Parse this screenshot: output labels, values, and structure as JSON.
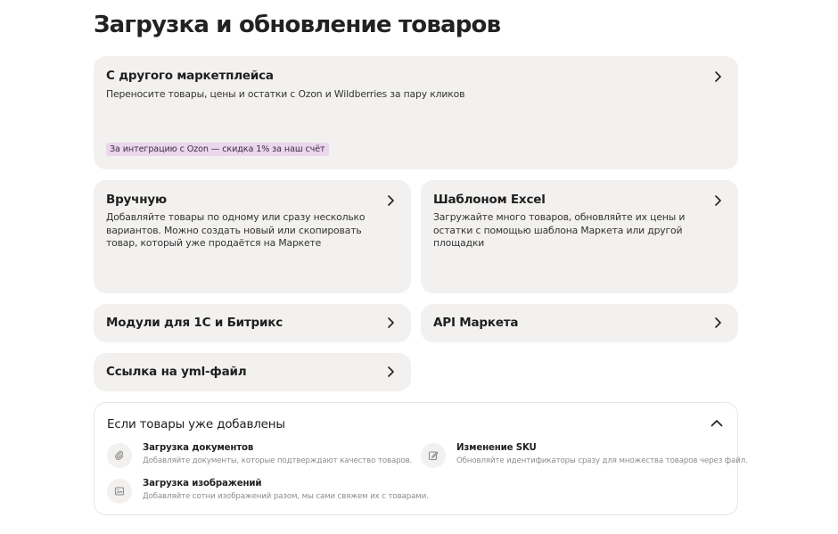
{
  "page": {
    "title": "Загрузка и обновление товаров"
  },
  "cards": {
    "marketplace": {
      "title": "С другого маркетплейса",
      "description": "Переносите товары, цены и остатки с Ozon и Wildberries за пару кликов",
      "promo": "За интеграцию с Ozon — скидка 1% за наш счёт",
      "icon": "chevron-right-icon"
    },
    "manual": {
      "title": "Вручную",
      "description": "Добавляйте товары по одному или сразу несколько вариантов. Можно создать новый или скопировать товар, который уже продаётся на Маркете",
      "icon": "chevron-right-icon"
    },
    "excel": {
      "title": "Шаблоном Excel",
      "description": "Загружайте много товаров, обновляйте их цены и остатки с помощью шаблона Маркета или другой площадки",
      "icon": "chevron-right-icon"
    },
    "modules": {
      "title": "Модули для 1С и Битрикс",
      "icon": "chevron-right-icon"
    },
    "api": {
      "title": "API Маркета",
      "icon": "chevron-right-icon"
    },
    "yml": {
      "title": "Ссылка на yml-файл",
      "icon": "chevron-right-icon"
    }
  },
  "added_section": {
    "title": "Если товары уже добавлены",
    "toggle_icon": "chevron-up-icon",
    "items": [
      {
        "title": "Загрузка документов",
        "description": "Добавляйте документы, которые подтверждают качество товаров.",
        "icon": "paperclip-icon"
      },
      {
        "title": "Изменение SKU",
        "description": "Обновляйте идентификаторы сразу для множества товаров через файл.",
        "icon": "edit-icon"
      },
      {
        "title": "Загрузка изображений",
        "description": "Добавляйте сотни изображений разом, мы сами свяжем их с товарами.",
        "icon": "image-icon"
      }
    ]
  }
}
